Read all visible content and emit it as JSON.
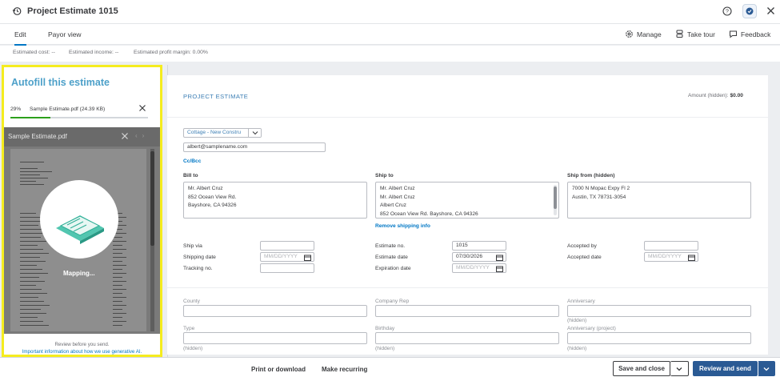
{
  "header": {
    "title": "Project Estimate 1015",
    "history_icon": "history-icon",
    "help_icon": "help-icon",
    "assistant_icon": "assistant-icon",
    "close_icon": "close-icon"
  },
  "tabs": [
    {
      "label": "Edit",
      "active": true
    },
    {
      "label": "Payor view",
      "active": false
    }
  ],
  "toolbar": {
    "manage": "Manage",
    "tour": "Take tour",
    "feedback": "Feedback"
  },
  "metrics": {
    "cost": "Estimated cost: --",
    "income": "Estimated income: --",
    "margin": "Estimated profit margin: 0.00%"
  },
  "autofill": {
    "title": "Autofill this estimate",
    "progress_label": "29%",
    "progress": 0.29,
    "file": "Sample Estimate.pdf (24.39 KB)",
    "preview_name": "Sample Estimate.pdf",
    "mapping": "Mapping...",
    "review": "Review before you send.",
    "link": "Important information about how we use generative AI."
  },
  "form": {
    "title": "PROJECT ESTIMATE",
    "amount_label": "Amount (hidden):",
    "amount_value": "$0.00",
    "customer": "Cottage - New Constru",
    "email": "albert@samplename.com",
    "cc_bcc": "Cc/Bcc",
    "bill_to": {
      "label": "Bill to",
      "lines": [
        "Mr. Albert Cruz",
        "852 Ocean View Rd.",
        "Bayshore, CA  94326"
      ]
    },
    "ship_to": {
      "label": "Ship to",
      "lines": [
        "Mr. Albert Cruz",
        "Mr. Albert Cruz",
        "Albert Cruz",
        "852 Ocean View Rd. Bayshore, CA 94326"
      ]
    },
    "ship_from": {
      "label": "Ship from (hidden)",
      "lines": [
        "7000 N Mopac Expy Fl 2",
        "Austin, TX 78731-3054"
      ]
    },
    "remove_shipping": "Remove shipping info",
    "ship_via": "Ship via",
    "shipping_date": "Shipping date",
    "tracking_no": "Tracking no.",
    "estimate_no": "Estimate no.",
    "estimate_no_value": "1015",
    "estimate_date": "Estimate date",
    "estimate_date_value": "07/30/2026",
    "expiration_date": "Expiration date",
    "accepted_by": "Accepted by",
    "accepted_date": "Accepted date",
    "date_placeholder": "MM/DD/YYYY",
    "custom": {
      "county": "County",
      "company_rep": "Company Rep",
      "anniversary": "Anniversary",
      "type": "Type",
      "birthday": "Birthday",
      "anniversary_project": "Anniversary (project)",
      "hidden": "(hidden)"
    }
  },
  "footer": {
    "print": "Print or download",
    "recurring": "Make recurring",
    "save_close": "Save and close",
    "review_send": "Review and send"
  }
}
